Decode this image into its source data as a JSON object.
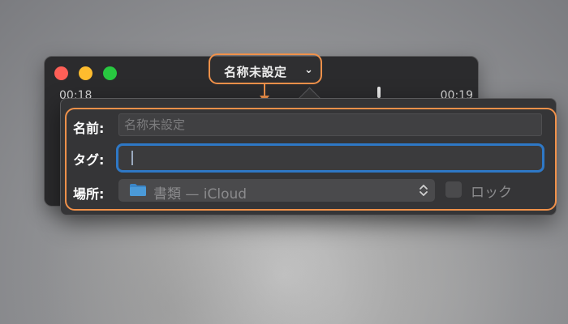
{
  "window": {
    "title": "名称未設定",
    "time_elapsed": "00:18",
    "time_remaining": "00:19"
  },
  "popover": {
    "name_label": "名前:",
    "name_placeholder": "名称未設定",
    "tag_label": "タグ:",
    "tag_value": "",
    "place_label": "場所:",
    "place_value": "書類 — iCloud",
    "lock_label": "ロック",
    "lock_checked": false
  },
  "icons": {
    "title_chevron": "chevron-down-icon",
    "folder": "folder-icon",
    "select_arrows": "updown-chevron-icon"
  },
  "colors": {
    "annotation": "#f0914a",
    "focus_ring": "#2e78c6",
    "close": "#fe5f57",
    "minimize": "#febc2e",
    "zoom": "#28c840",
    "folder": "#3a86c8"
  }
}
